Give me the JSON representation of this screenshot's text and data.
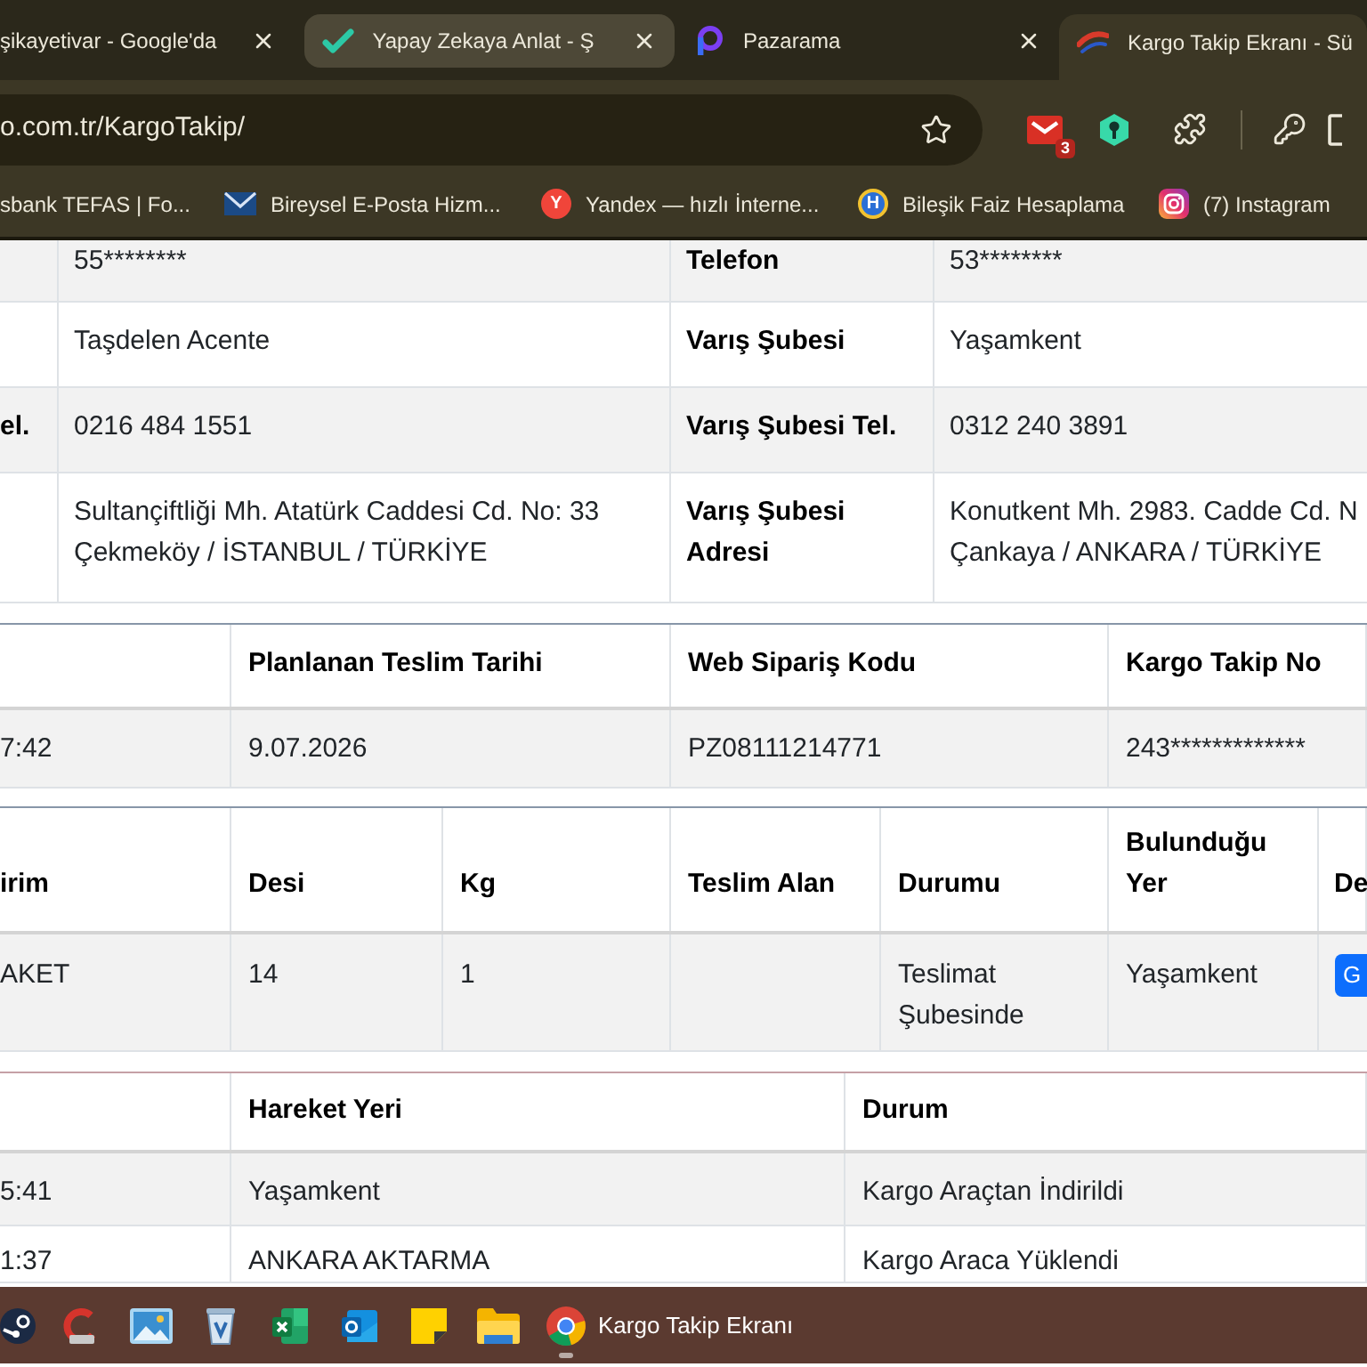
{
  "browser": {
    "tabs": [
      {
        "title": "şikayetivar - Google'da",
        "selected": false,
        "hovered": false
      },
      {
        "title": "Yapay Zekaya Anlat - Ş",
        "selected": false,
        "hovered": true
      },
      {
        "title": "Pazarama",
        "selected": false,
        "hovered": false
      },
      {
        "title": "Kargo Takip Ekranı - Sü",
        "selected": true,
        "hovered": false
      }
    ],
    "address": "o.com.tr/KargoTakip/",
    "extension_badge": "3",
    "bookmarks": [
      {
        "label": "sbank TEFAS | Fo..."
      },
      {
        "label": "Bireysel E-Posta Hizm..."
      },
      {
        "label": "Yandex — hızlı İnterne...",
        "icon_letter": "Y"
      },
      {
        "label": "Bileşik Faiz Hesaplama",
        "icon_letter": "H"
      },
      {
        "label": "(7) Instagram"
      }
    ]
  },
  "page": {
    "contact_table": {
      "rows": [
        {
          "value_1": "55********",
          "label_2": "Telefon",
          "value_2": "53********"
        },
        {
          "value_1": "Taşdelen Acente",
          "label_2": "Varış Şubesi",
          "value_2": "Yaşamkent"
        },
        {
          "label_1": "el.",
          "value_1": "0216 484 1551",
          "label_2": "Varış Şubesi Tel.",
          "value_2": "0312 240 3891"
        },
        {
          "value_1": "Sultançiftliği Mh. Atatürk Caddesi Cd. No: 33\nÇekmeköy / İSTANBUL / TÜRKİYE",
          "label_2": "Varış Şubesi\nAdresi",
          "value_2": "Konutkent Mh. 2983. Cadde Cd. N\nÇankaya / ANKARA / TÜRKİYE"
        }
      ]
    },
    "shipment_table": {
      "columns": [
        null,
        "Planlanan Teslim Tarihi",
        "Web Sipariş Kodu",
        "Kargo Takip No"
      ],
      "rows": [
        [
          "7:42",
          "9.07.2026",
          "PZ08111214771",
          "243*************"
        ]
      ]
    },
    "package_table": {
      "columns": [
        "irim",
        "Desi",
        "Kg",
        "Teslim Alan",
        "Durumu",
        "Bulunduğu\nYer",
        "De"
      ],
      "rows": [
        {
          "cells": [
            "AKET",
            "14",
            "1",
            null,
            "Teslimat\nŞubesinde",
            "Yaşamkent"
          ],
          "button": "G"
        }
      ]
    },
    "movement_table": {
      "columns": [
        null,
        "Hareket Yeri",
        "Durum"
      ],
      "rows": [
        [
          "5:41",
          "Yaşamkent",
          "Kargo Araçtan İndirildi"
        ],
        [
          "1:37",
          "ANKARA AKTARMA",
          "Kargo Araca Yüklendi"
        ]
      ]
    }
  },
  "taskbar": {
    "window_title": "Kargo Takip Ekranı"
  }
}
